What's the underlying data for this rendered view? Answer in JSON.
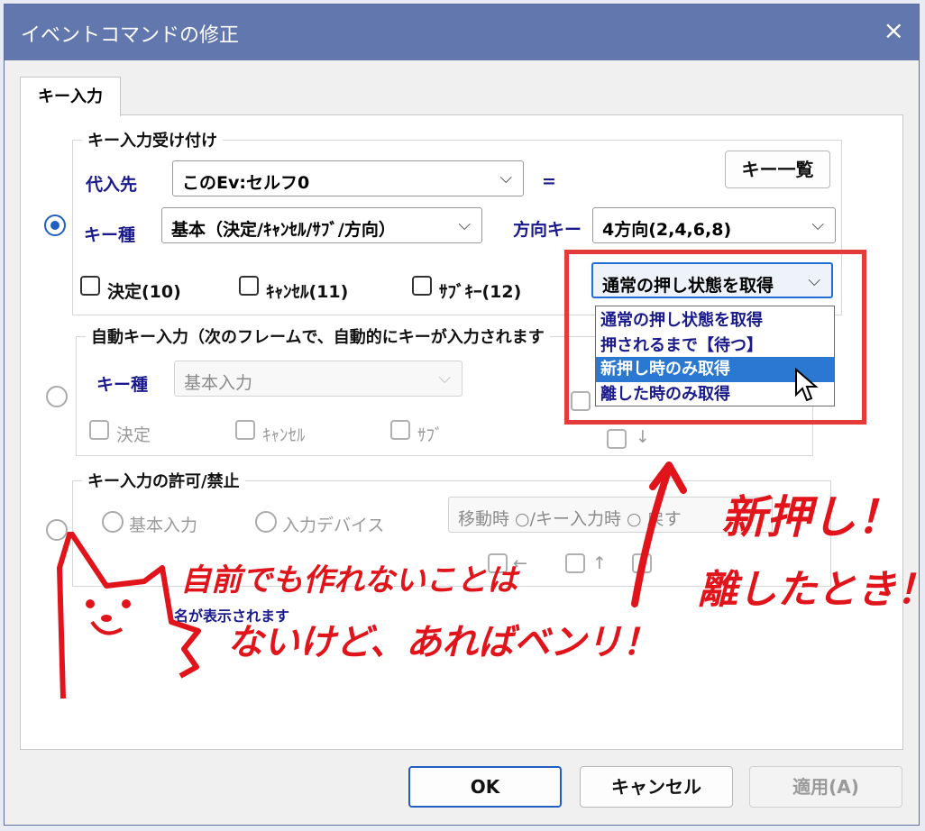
{
  "window": {
    "title": "イベントコマンドの修正",
    "close_icon": "×"
  },
  "tab": {
    "label": "キー入力"
  },
  "key_input_accept": {
    "legend": "キー入力受け付け",
    "assign_label": "代入先",
    "assign_value": "このEv:セルフ0",
    "equals": "=",
    "key_list_button": "キー一覧",
    "key_type_label": "キー種",
    "key_type_value": "基本（決定/ｷｬﾝｾﾙ/ｻﾌﾞ/方向）",
    "direction_label": "方向キー",
    "direction_value": "4方向(2,4,6,8)",
    "checkboxes": [
      "決定(10)",
      "ｷｬﾝｾﾙ(11)",
      "ｻﾌﾞｷｰ(12)"
    ],
    "mode_value": "通常の押し状態を取得",
    "mode_options": [
      "通常の押し状態を取得",
      "押されるまで【待つ】",
      "新押し時のみ取得",
      "離した時のみ取得"
    ],
    "selected_option_index": 2
  },
  "auto_key_input": {
    "legend": "自動キー入力（次のフレームで、自動的にキーが入力されます",
    "key_type_label": "キー種",
    "key_type_value": "基本入力",
    "checkboxes": [
      "決定",
      "ｷｬﾝｾﾙ",
      "ｻﾌﾞ"
    ],
    "arrow_down": "↓"
  },
  "key_permission": {
    "legend": "キー入力の許可/禁止",
    "radio_basic": "基本入力",
    "radio_device": "入力デバイス",
    "mode_text": "移動時 ○/キー入力時 ○ 戻す",
    "arrows": [
      "←",
      "↑"
    ],
    "note": "名が表示されます"
  },
  "annotations": {
    "cat_note_line1": "自前でも作れないことは",
    "cat_note_line2": "ないけど、あればベンリ！",
    "right_note_line1": "新押し！",
    "right_note_line2": "離したとき！"
  },
  "buttons": {
    "ok": "OK",
    "cancel": "キャンセル",
    "apply": "適用(A)"
  },
  "colors": {
    "titlebar": "#6277ad",
    "accent": "#1f5fbf",
    "highlight": "#2a78d2",
    "annotation_red": "#e0141a"
  }
}
